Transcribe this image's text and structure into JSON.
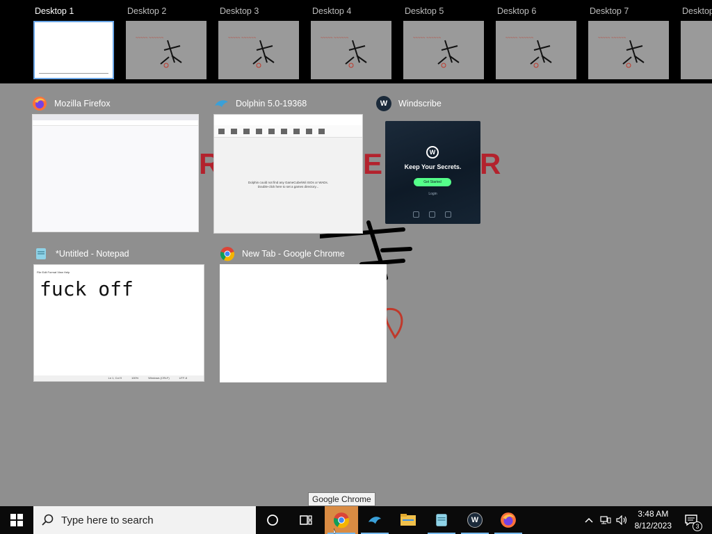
{
  "desktops": [
    {
      "label": "Desktop 1",
      "active": true
    },
    {
      "label": "Desktop 2",
      "active": false
    },
    {
      "label": "Desktop 3",
      "active": false
    },
    {
      "label": "Desktop 4",
      "active": false
    },
    {
      "label": "Desktop 5",
      "active": false
    },
    {
      "label": "Desktop 6",
      "active": false
    },
    {
      "label": "Desktop 7",
      "active": false
    },
    {
      "label": "Desktop",
      "active": false
    }
  ],
  "windows": {
    "firefox": {
      "title": "Mozilla Firefox",
      "icon": "firefox-icon"
    },
    "dolphin": {
      "title": "Dolphin 5.0-19368",
      "icon": "dolphin-icon",
      "toolbar": [
        "Open",
        "Refresh",
        "Play",
        "Stop",
        "Fullscr",
        "ScrShot",
        "Config",
        "Graphics",
        "Controllers"
      ],
      "message_line1": "Dolphin could not find any GameCube/Wii ISOs or WADs.",
      "message_line2": "Double-click here to set a games directory..."
    },
    "windscribe": {
      "title": "Windscribe",
      "icon": "windscribe-icon",
      "tagline": "Keep Your Secrets.",
      "button": "Get Started",
      "login": "Login"
    },
    "notepad": {
      "title": "*Untitled - Notepad",
      "icon": "notepad-icon",
      "menu": "File   Edit   Format   View   Help",
      "content": "fuck off",
      "status": [
        "Ln 1, Col 9",
        "100%",
        "Windows (CRLF)",
        "UTF-8"
      ]
    },
    "chrome": {
      "title": "New Tab - Google Chrome",
      "icon": "chrome-icon"
    }
  },
  "taskbar": {
    "search_placeholder": "Type here to search",
    "tooltip": "Google Chrome",
    "pinned": [
      "chrome-icon",
      "dolphin-icon",
      "file-explorer-icon",
      "notepad-icon",
      "windscribe-icon",
      "firefox-icon"
    ],
    "time": "3:48 AM",
    "date": "8/12/2023",
    "notification_count": "3"
  },
  "colors": {
    "accent": "#76b9ed",
    "active_app": "#d98b43",
    "windscribe_green": "#55ff8a"
  }
}
